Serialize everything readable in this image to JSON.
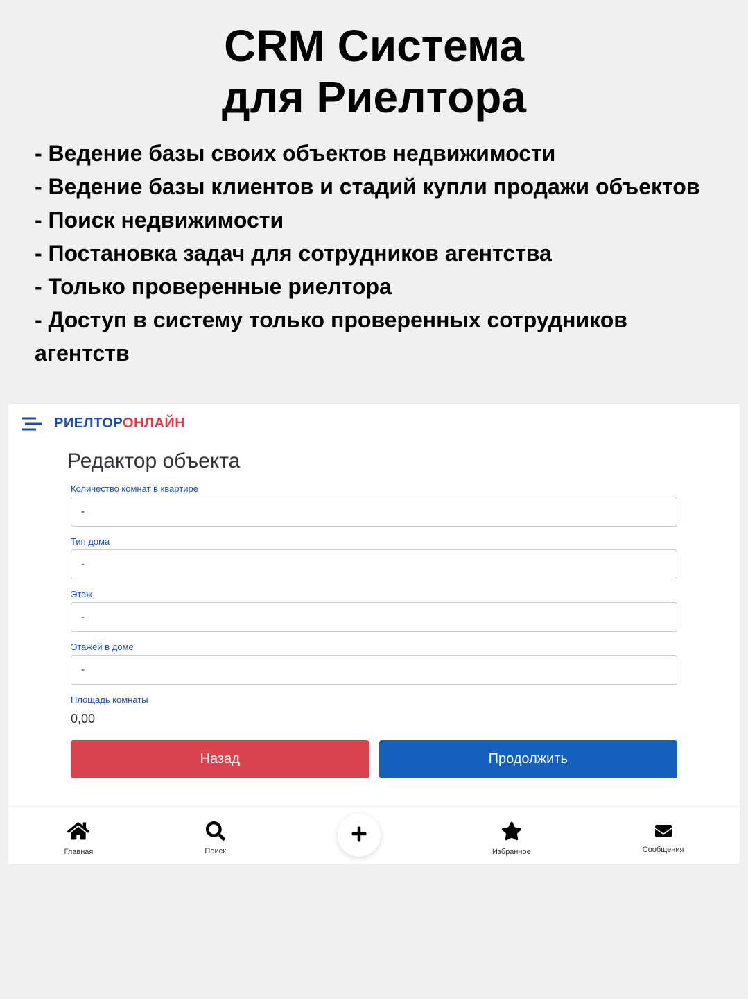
{
  "hero": {
    "title_line1": "CRM Система",
    "title_line2": "для Риелтора",
    "features": [
      "- Ведение базы своих объектов недвижимости",
      "- Ведение базы клиентов и стадий купли продажи объектов",
      "- Поиск недвижимости",
      "- Постановка задач для сотрудников агентства",
      "- Только проверенные риелтора",
      "- Доступ в систему только проверенных сотрудников агентств"
    ]
  },
  "app": {
    "logo_part1": "РИЕЛТОР",
    "logo_part2": "ОНЛАЙН",
    "page_title": "Редактор объекта",
    "fields": {
      "rooms": {
        "label": "Количество комнат в квартире",
        "value": "-"
      },
      "house_type": {
        "label": "Тип дома",
        "value": "-"
      },
      "floor": {
        "label": "Этаж",
        "value": "-"
      },
      "floors_total": {
        "label": "Этажей в доме",
        "value": "-"
      },
      "room_area": {
        "label": "Площадь комнаты",
        "value": "0,00"
      }
    },
    "buttons": {
      "back": "Назад",
      "continue": "Продолжить"
    },
    "tabs": {
      "home": "Главная",
      "search": "Поиск",
      "favorites": "Избранное",
      "messages": "Сообщения"
    }
  }
}
